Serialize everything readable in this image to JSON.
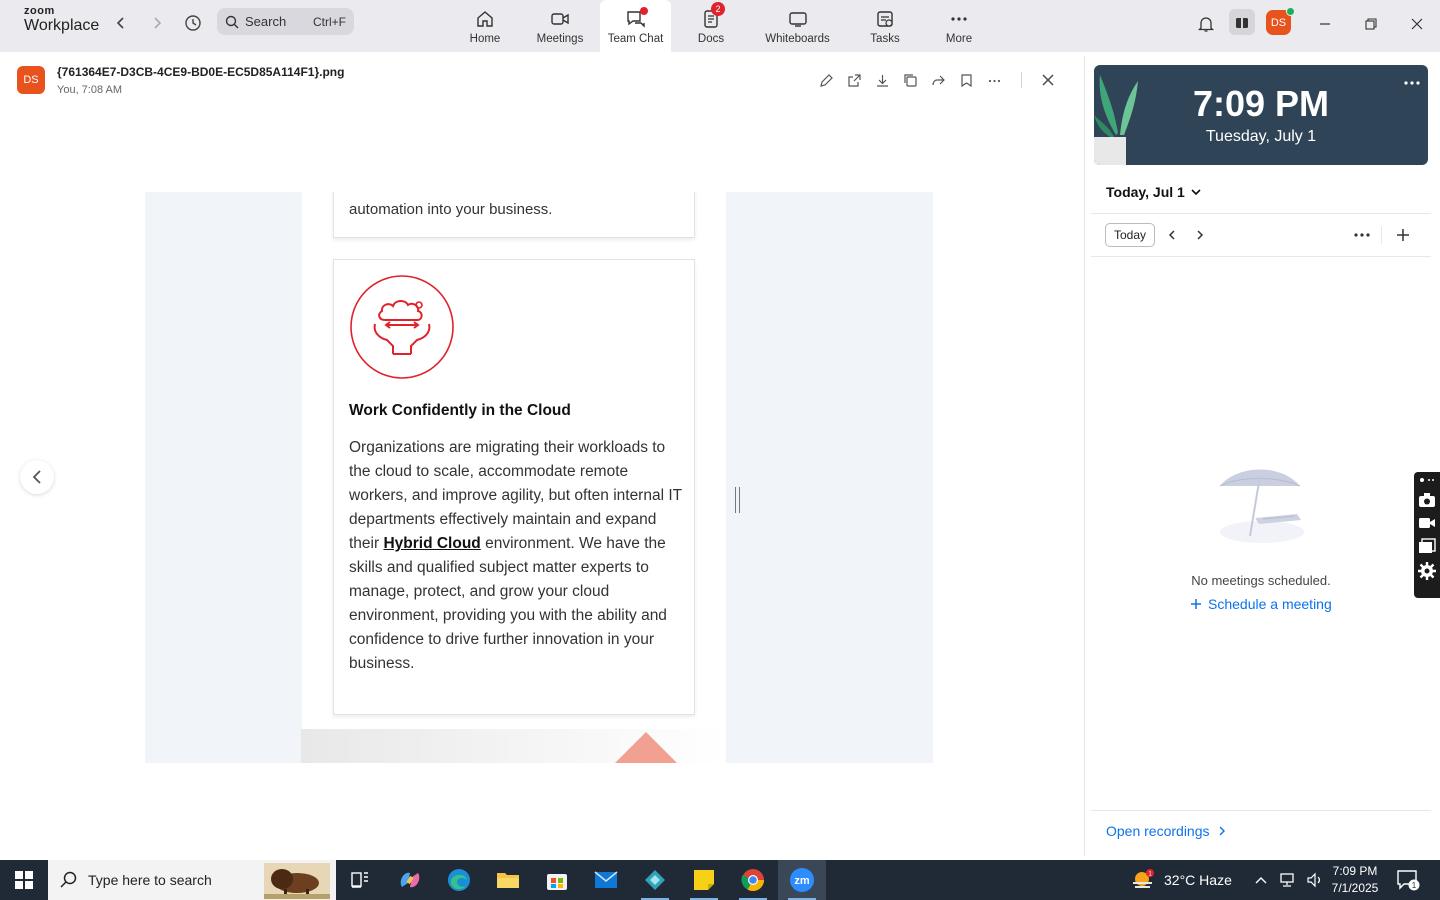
{
  "app": {
    "logo_top": "zoom",
    "logo_bottom": "Workplace",
    "search_label": "Search",
    "search_shortcut": "Ctrl+F",
    "user_initials": "DS"
  },
  "tabs": [
    {
      "label": "Home"
    },
    {
      "label": "Meetings"
    },
    {
      "label": "Team Chat"
    },
    {
      "label": "Docs",
      "badge": "2"
    },
    {
      "label": "Whiteboards"
    },
    {
      "label": "Tasks"
    },
    {
      "label": "More"
    }
  ],
  "file": {
    "avatar": "DS",
    "name": "{761364E7-D3CB-4CE9-BD0E-EC5D85A114F1}.png",
    "meta": "You, 7:08 AM"
  },
  "image": {
    "top_card_text": "automation into your business.",
    "card_title": "Work Confidently in the Cloud",
    "body_before_link": "Organizations are migrating their workloads to the cloud to scale, accommodate remote workers, and improve agility, but often internal IT departments effectively maintain and expand their ",
    "body_link": "Hybrid Cloud",
    "body_after_link": " environment. We have the skills and qualified subject matter experts to manage, protect, and grow your cloud environment, providing you with the ability and confidence to drive further innovation in your business.",
    "accent_color": "#e0232b"
  },
  "panel": {
    "time": "7:09 PM",
    "date": "Tuesday, July 1",
    "date_selector": "Today, Jul 1",
    "today_button": "Today",
    "empty_message": "No meetings scheduled.",
    "schedule_link": "Schedule a meeting",
    "recordings_link": "Open recordings"
  },
  "taskbar": {
    "search_placeholder": "Type here to search",
    "weather": "32°C  Haze",
    "weather_badge": "1",
    "time": "7:09 PM",
    "date": "7/1/2025",
    "notification_count": "1"
  }
}
